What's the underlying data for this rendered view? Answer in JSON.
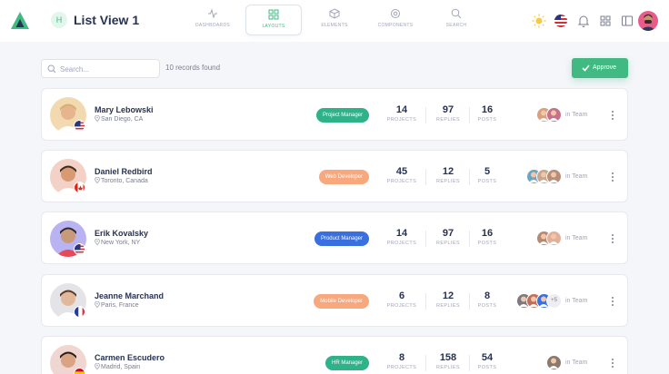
{
  "header": {
    "page_badge": "H",
    "page_title": "List View 1",
    "tabs": [
      {
        "label": "DASHBOARDS",
        "icon": "activity-icon"
      },
      {
        "label": "LAYOUTS",
        "icon": "grid-icon",
        "active": true
      },
      {
        "label": "ELEMENTS",
        "icon": "box-icon"
      },
      {
        "label": "COMPONENTS",
        "icon": "cog-icon"
      },
      {
        "label": "SEARCH",
        "icon": "search-icon"
      }
    ]
  },
  "toolbar": {
    "search_placeholder": "Search...",
    "records_label": "10 records found",
    "approve_label": "Approve"
  },
  "colors": {
    "primary": "#41b983",
    "orange": "#f9a77d",
    "blue": "#3a6fe0",
    "text": "#283252",
    "muted": "#a2a5b9"
  },
  "rows": [
    {
      "name": "Mary Lebowski",
      "location": "San Diego, CA",
      "role": "Project Manager",
      "role_color": "#2fb18a",
      "flag": "us",
      "projects": "14",
      "replies": "97",
      "posts": "16",
      "team_more": ""
    },
    {
      "name": "Daniel Redbird",
      "location": "Toronto, Canada",
      "role": "Web Developer",
      "role_color": "#f9a77d",
      "flag": "ca",
      "projects": "45",
      "replies": "12",
      "posts": "5",
      "team_more": ""
    },
    {
      "name": "Erik Kovalsky",
      "location": "New York, NY",
      "role": "Product Manager",
      "role_color": "#3a6fe0",
      "flag": "us",
      "projects": "14",
      "replies": "97",
      "posts": "16",
      "team_more": ""
    },
    {
      "name": "Jeanne Marchand",
      "location": "Paris, France",
      "role": "Mobile Developer",
      "role_color": "#f9a77d",
      "flag": "fr",
      "projects": "6",
      "replies": "12",
      "posts": "8",
      "team_more": "+5"
    },
    {
      "name": "Carmen Escudero",
      "location": "Madrid, Spain",
      "role": "HR Manager",
      "role_color": "#2fb18a",
      "flag": "es",
      "projects": "8",
      "replies": "158",
      "posts": "54",
      "team_more": ""
    }
  ],
  "labels": {
    "projects": "PROJECTS",
    "replies": "REPLIES",
    "posts": "POSTS",
    "in_team": "in Team"
  }
}
